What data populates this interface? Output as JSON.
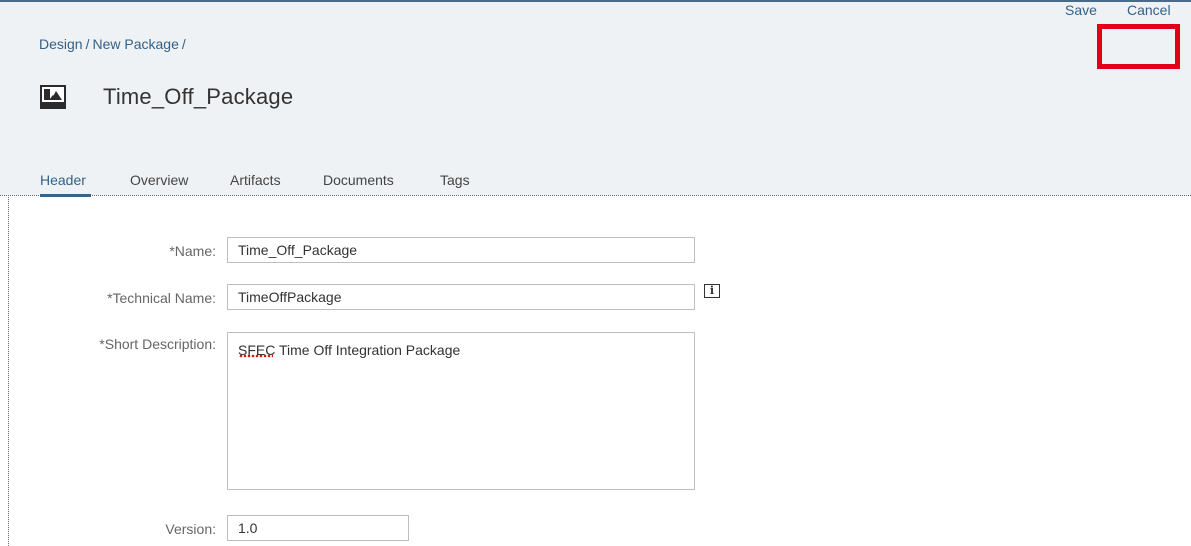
{
  "breadcrumb": {
    "items": [
      "Design",
      "New Package"
    ],
    "separator": "/"
  },
  "header": {
    "title": "Time_Off_Package",
    "icon": "package-image-icon"
  },
  "actions": {
    "save_label": "Save",
    "cancel_label": "Cancel",
    "highlight_color": "#e0001a"
  },
  "tabs": [
    {
      "label": "Header",
      "active": true
    },
    {
      "label": "Overview",
      "active": false
    },
    {
      "label": "Artifacts",
      "active": false
    },
    {
      "label": "Documents",
      "active": false
    },
    {
      "label": "Tags",
      "active": false
    }
  ],
  "form": {
    "name": {
      "label": "*Name:",
      "value": "Time_Off_Package"
    },
    "technical_name": {
      "label": "*Technical Name:",
      "value": "TimeOffPackage",
      "info_icon": "info-icon"
    },
    "short_description": {
      "label": "*Short Description:",
      "value": "SFEC Time Off Integration Package"
    },
    "version": {
      "label": "Version:",
      "value": "1.0"
    }
  },
  "colors": {
    "link": "#346187",
    "header_bg": "#eef2f5",
    "accent_bar": "#4a6a87"
  }
}
